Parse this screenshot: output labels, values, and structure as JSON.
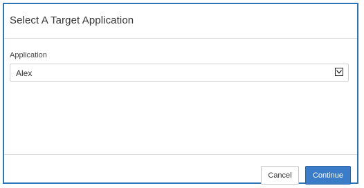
{
  "dialog": {
    "title": "Select A Target Application"
  },
  "form": {
    "application_label": "Application",
    "application_value": "Alex"
  },
  "footer": {
    "cancel_label": "Cancel",
    "continue_label": "Continue"
  },
  "icons": {
    "select_arrow": "chevron-down-icon"
  },
  "colors": {
    "border_accent": "#2e75b6",
    "primary_button": "#3a7cc7"
  }
}
